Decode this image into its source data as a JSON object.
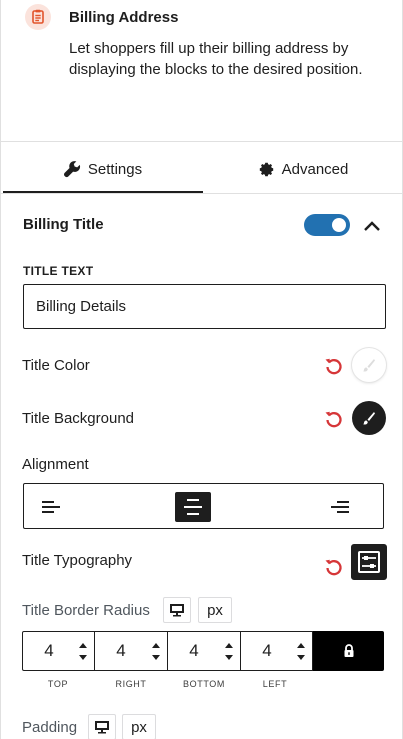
{
  "block": {
    "title": "Billing Address",
    "description": "Let shoppers fill up their billing address by displaying the blocks to the desired position.",
    "icon": "billing-address-icon",
    "accent": "#e2542c"
  },
  "tabs": [
    {
      "label": "Settings",
      "icon": "wrench-icon",
      "active": true
    },
    {
      "label": "Advanced",
      "icon": "gear-icon",
      "active": false
    }
  ],
  "panel": {
    "title": "Billing Title",
    "enabled": true,
    "toggle_color": "#2271b1",
    "title_text_label": "TITLE TEXT",
    "title_text_value": "Billing Details",
    "title_color_label": "Title Color",
    "title_background_label": "Title Background",
    "alignment_label": "Alignment",
    "alignment_options": [
      "left",
      "center",
      "right"
    ],
    "alignment_selected": "center",
    "typography_label": "Title Typography",
    "border_radius_label": "Title Border Radius",
    "unit": "px",
    "border_radius": [
      {
        "value": "4",
        "caption": "TOP"
      },
      {
        "value": "4",
        "caption": "RIGHT"
      },
      {
        "value": "4",
        "caption": "BOTTOM"
      },
      {
        "value": "4",
        "caption": "LEFT"
      }
    ],
    "padding_label": "Padding",
    "padding_unit": "px",
    "reset_color": "#d63638"
  }
}
